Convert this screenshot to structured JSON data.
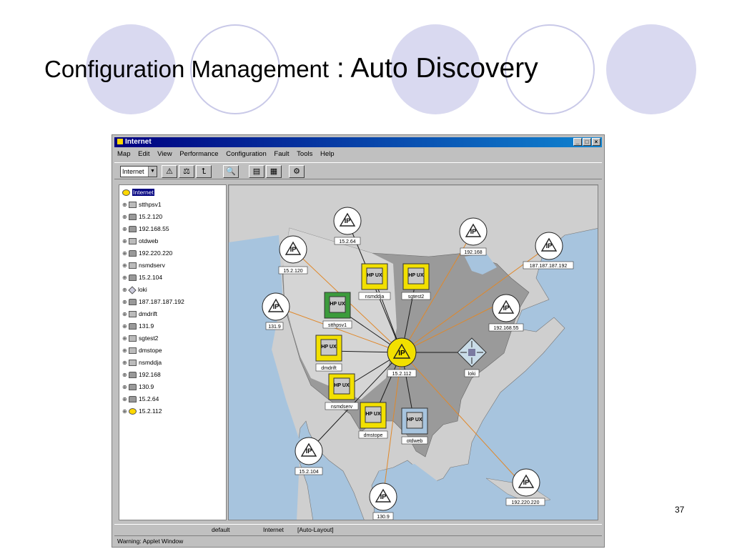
{
  "slide": {
    "title_part1": "Configuration Management",
    "title_part2": " : Auto Discovery",
    "page_number": "37"
  },
  "window": {
    "title": "Internet",
    "menu": [
      "Map",
      "Edit",
      "View",
      "Performance",
      "Configuration",
      "Fault",
      "Tools",
      "Help"
    ],
    "map_selector_value": "Internet"
  },
  "tree": {
    "root": "Internet",
    "items": [
      {
        "label": "stthpsv1",
        "type": "host"
      },
      {
        "label": "15.2.120",
        "type": "network"
      },
      {
        "label": "192.168.55",
        "type": "network"
      },
      {
        "label": "otdweb",
        "type": "host"
      },
      {
        "label": "192.220.220",
        "type": "network"
      },
      {
        "label": "nsmdserv",
        "type": "host"
      },
      {
        "label": "15.2.104",
        "type": "network"
      },
      {
        "label": "loki",
        "type": "router"
      },
      {
        "label": "187.187.187.192",
        "type": "network"
      },
      {
        "label": "dmdrift",
        "type": "host"
      },
      {
        "label": "131.9",
        "type": "network"
      },
      {
        "label": "sgtest2",
        "type": "host"
      },
      {
        "label": "dmstope",
        "type": "host"
      },
      {
        "label": "nsmddja",
        "type": "host"
      },
      {
        "label": "192.168",
        "type": "network"
      },
      {
        "label": "130.9",
        "type": "network"
      },
      {
        "label": "15.2.64",
        "type": "network"
      },
      {
        "label": "15.2.112",
        "type": "network-hub"
      }
    ]
  },
  "map": {
    "ip_nodes": [
      {
        "label": "15.2.64"
      },
      {
        "label": "192.168"
      },
      {
        "label": "187.187.187.192"
      },
      {
        "label": "15.2.120"
      },
      {
        "label": "131.9"
      },
      {
        "label": "192.168.55"
      },
      {
        "label": "15.2.104"
      },
      {
        "label": "130.9"
      },
      {
        "label": "192.220.220"
      }
    ],
    "hub_node": {
      "label": "15.2.112"
    },
    "router_node": {
      "label": "loki"
    },
    "hosts": [
      {
        "label": "nsmddja",
        "badge": "HP UX"
      },
      {
        "label": "sgtest2",
        "badge": "HP UX"
      },
      {
        "label": "stthpsv1",
        "badge": "HP UX"
      },
      {
        "label": "dmdrift",
        "badge": "HP UX"
      },
      {
        "label": "nsmdserv",
        "badge": "HP UX"
      },
      {
        "label": "dmstope",
        "badge": "HP UX"
      },
      {
        "label": "otdweb",
        "badge": "HP UX"
      }
    ],
    "ip_glyph": "IP",
    "colors": {
      "hub": "#f2e000",
      "host_yellow": "#f2e000",
      "host_green": "#3c9b3c",
      "link": "#1a1a1a",
      "orange_link": "#e0882a",
      "ocean": "#a7c4de",
      "land": "#cfcfcf"
    }
  },
  "status": {
    "map": "default",
    "submap": "Internet",
    "mode": "[Auto-Layout]",
    "warning": "Warning: Applet Window"
  }
}
